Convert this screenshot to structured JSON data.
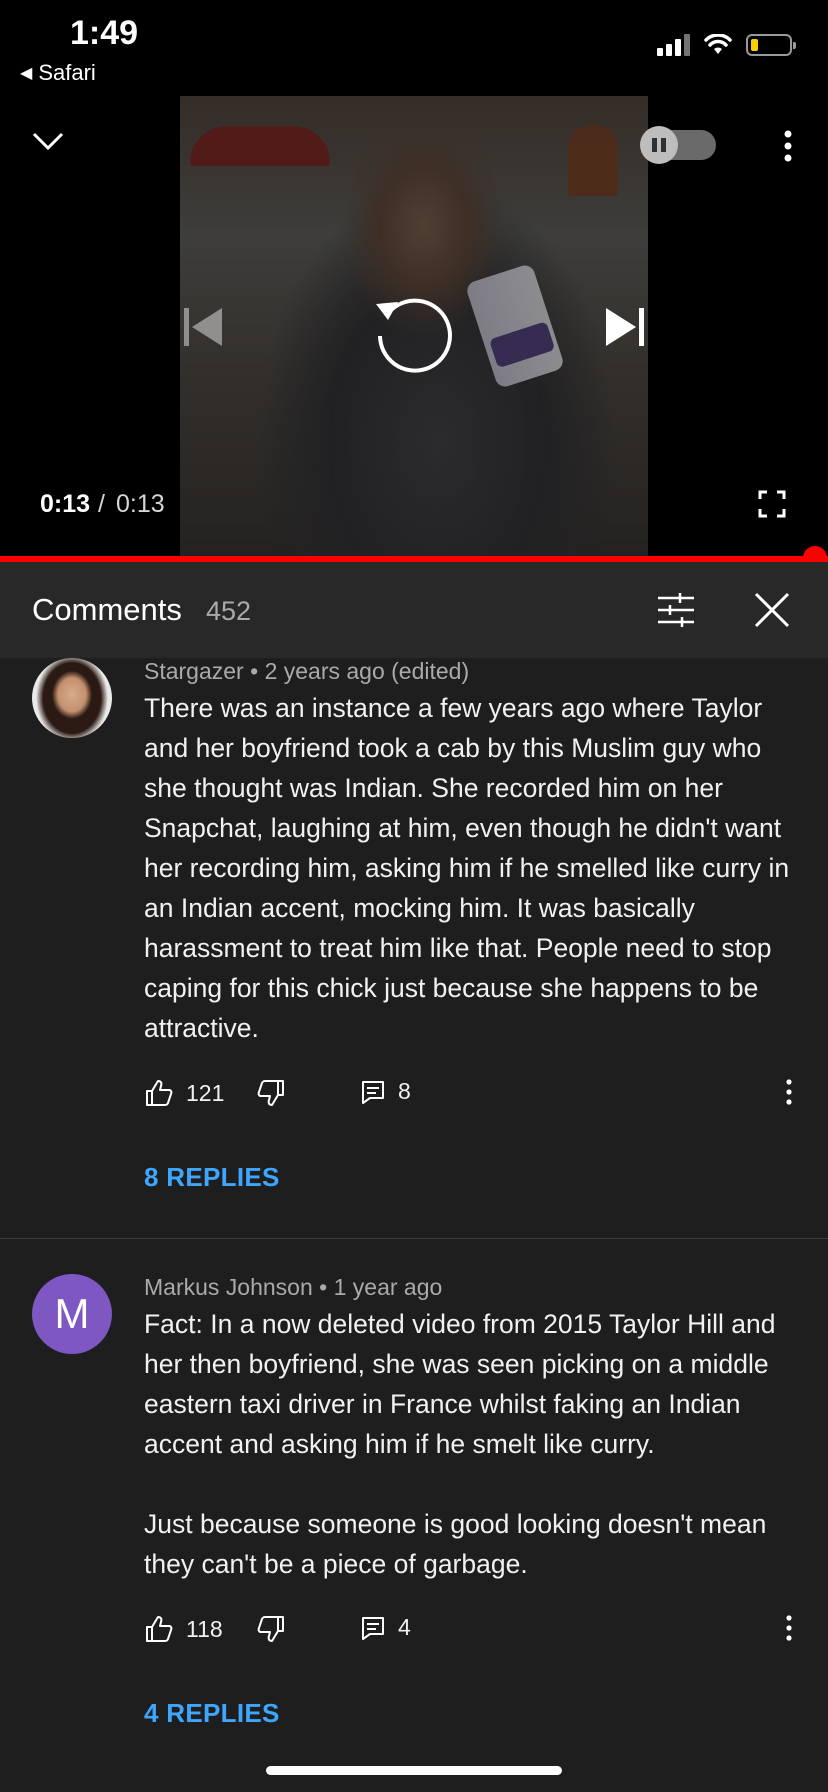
{
  "status_bar": {
    "time": "1:49",
    "back_app": "Safari"
  },
  "video": {
    "time_current": "0:13",
    "time_separator": "/",
    "time_total": "0:13",
    "progress_fraction": 1.0
  },
  "comments": {
    "title": "Comments",
    "count": "452",
    "items": [
      {
        "author": "Stargazer",
        "age": "2 years ago (edited)",
        "text": "There was an instance a few years ago where Taylor and her boyfriend took a cab by this Muslim guy who she thought was Indian. She recorded him on her Snapchat, laughing at him, even though he didn't want her recording him, asking him if he smelled like curry in an Indian accent, mocking him. It was basically harassment to treat him like that. People need to stop caping for this chick just because she happens to be attractive.",
        "likes": "121",
        "reply_count": "8",
        "replies_label": "8 REPLIES"
      },
      {
        "author": "Markus Johnson",
        "avatar_letter": "M",
        "age": "1 year ago",
        "text": "Fact: In a now deleted video from 2015 Taylor Hill and her then boyfriend, she was seen picking on a middle eastern taxi driver in France whilst faking an Indian accent and asking him if he smelt like curry.\n\nJust because someone is good looking doesn't mean they can't be a piece of garbage.",
        "likes": "118",
        "reply_count": "4",
        "replies_label": "4 REPLIES"
      }
    ]
  },
  "colors": {
    "accent": "#3ea6ff",
    "progress": "#ff0000",
    "avatar_m": "#7e57c2"
  }
}
